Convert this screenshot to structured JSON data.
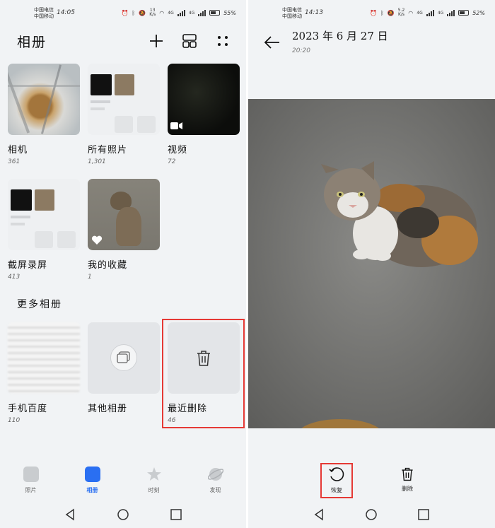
{
  "left": {
    "status": {
      "carrier1": "中国电信",
      "carrier2": "中国移动",
      "time": "14:05",
      "speed": "13",
      "speed_unit": "K/s",
      "net1": "4G",
      "net2": "4G",
      "battery": "55%"
    },
    "title": "相册",
    "albums": [
      {
        "name": "相机",
        "count": "361"
      },
      {
        "name": "所有照片",
        "count": "1,301"
      },
      {
        "name": "视频",
        "count": "72"
      },
      {
        "name": "截屏录屏",
        "count": "413"
      },
      {
        "name": "我的收藏",
        "count": "1"
      }
    ],
    "more_title": "更多相册",
    "more_albums": [
      {
        "name": "手机百度",
        "count": "110"
      },
      {
        "name": "其他相册",
        "count": ""
      },
      {
        "name": "最近删除",
        "count": "46"
      }
    ],
    "nav": [
      {
        "label": "照片",
        "icon": "photos-icon",
        "active": false
      },
      {
        "label": "相册",
        "icon": "albums-icon",
        "active": true
      },
      {
        "label": "时刻",
        "icon": "moments-icon",
        "active": false
      },
      {
        "label": "发现",
        "icon": "discover-icon",
        "active": false
      }
    ]
  },
  "right": {
    "status": {
      "carrier1": "中国电信",
      "carrier2": "中国移动",
      "time": "14:13",
      "speed": "5.2",
      "speed_unit": "K/s",
      "net1": "4G",
      "net2": "4G",
      "battery": "52%"
    },
    "date": "2023 年 6 月 27 日",
    "time": "20:20",
    "actions": [
      {
        "label": "恢复",
        "icon": "restore-icon"
      },
      {
        "label": "删除",
        "icon": "trash-icon"
      }
    ]
  },
  "colors": {
    "accent": "#2a6ff2",
    "highlight": "#e53935",
    "background": "#f1f3f5"
  }
}
